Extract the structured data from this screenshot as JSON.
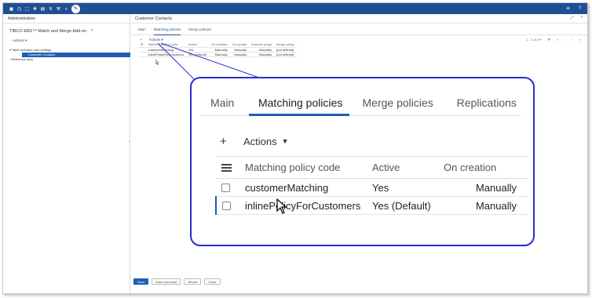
{
  "topbar": {
    "icons": [
      "grid-icon",
      "clock-icon",
      "document-icon",
      "cube-icon",
      "database-icon",
      "data-check-icon",
      "wrench-icon",
      "search-icon",
      "pencil-icon"
    ],
    "glyphs": [
      "▣",
      "◷",
      "⬚",
      "❖",
      "▤",
      "↯",
      "⚒",
      "⌕",
      "✎"
    ],
    "right_glyphs": [
      "≡",
      "?"
    ]
  },
  "left_panel": {
    "header": "Administration",
    "title": "TIBCO EBX™ Match and Merge Add-on",
    "title_marker": "*",
    "actions_label": "Actions ▾",
    "tree": [
      {
        "label": "▾ Table activation and settings",
        "selected": false
      },
      {
        "label": "Customer Contacts",
        "selected": true
      },
      {
        "label": "› Reference data",
        "selected": false
      }
    ],
    "splitter_glyph": "‹"
  },
  "right_panel": {
    "header": "Customer Contacts",
    "header_icons": [
      "⤢",
      "?"
    ],
    "tabs": [
      "Main",
      "Matching policies",
      "Merge policies"
    ],
    "active_tab": "Matching policies",
    "toolbar": {
      "plus": "+",
      "actions": "Actions ▾"
    },
    "pager": {
      "range": "1 - 2 of 2 ▾",
      "filter": "⧩",
      "nav": [
        "«",
        "‹",
        "›",
        "»"
      ]
    },
    "table": {
      "columns": [
        "☰",
        "Matching policy code",
        "Active",
        "On creation",
        "On update",
        "Execute purge",
        "Merge policy"
      ],
      "rows": [
        [
          "",
          "customerMatching",
          "Yes",
          "Manually",
          "Manually",
          "Manually",
          "[not defined]"
        ],
        [
          "",
          "inlinePolicyForCustomers",
          "Yes (Default)",
          "Manually",
          "Manually",
          "Manually",
          "[not defined]"
        ]
      ]
    }
  },
  "buttons": {
    "save": "Save",
    "save_close": "Save and close",
    "revert": "Revert",
    "close": "Close"
  },
  "zoom": {
    "tabs": [
      "Main",
      "Matching policies",
      "Merge policies",
      "Replications"
    ],
    "active_tab": "Matching policies",
    "toolbar": {
      "plus": "+",
      "actions": "Actions",
      "caret": "▼"
    },
    "columns": [
      "Matching policy code",
      "Active",
      "On creation"
    ],
    "rows": [
      {
        "code": "customerMatching",
        "active": "Yes",
        "on_creation": "Manually"
      },
      {
        "code": "inlinePolicyForCustomers",
        "active": "Yes (Default)",
        "on_creation": "Manually"
      }
    ]
  },
  "colors": {
    "topbar": "#1f4f93",
    "accent": "#1f5fb4",
    "callout": "#2a2ad4"
  }
}
